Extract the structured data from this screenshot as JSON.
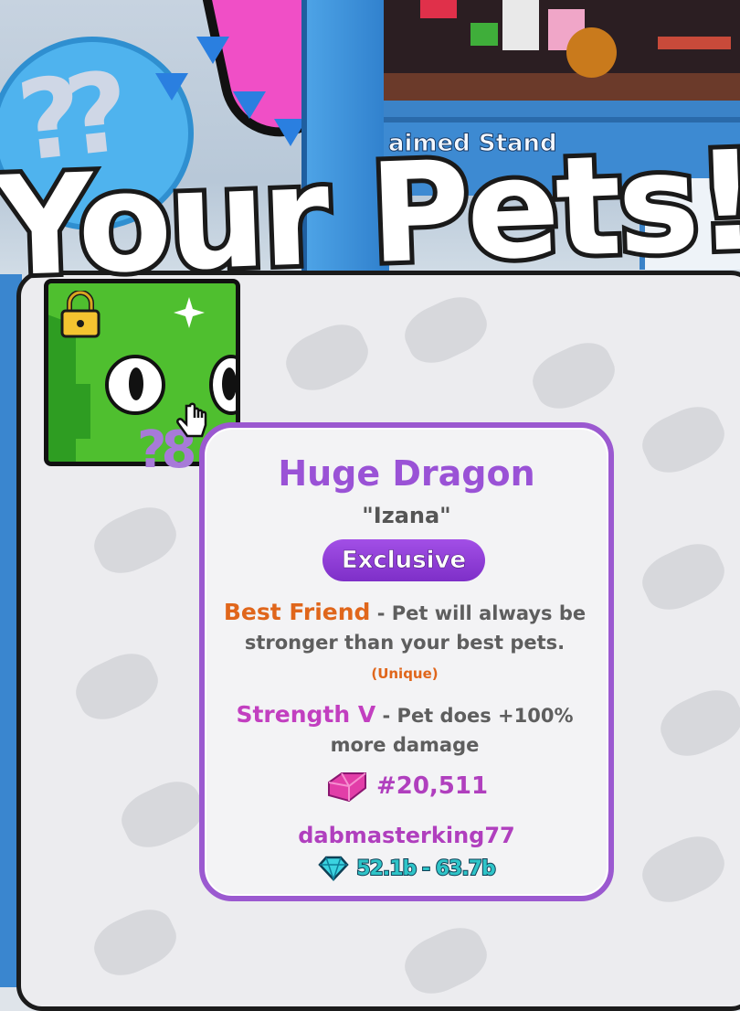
{
  "scene": {
    "stand_label": "aimed Stand"
  },
  "title": "Your Pets!",
  "pet_slot": {
    "locked_icon": "lock-icon",
    "sparkle_icon": "sparkle-icon",
    "corner_text": "?8"
  },
  "tooltip": {
    "pet_name": "Huge Dragon",
    "nickname": "\"Izana\"",
    "rarity": "Exclusive",
    "enchants": [
      {
        "name": "Best Friend",
        "separator": " - ",
        "description": "Pet will always be stronger than your best pets.",
        "tag": "(Unique)"
      },
      {
        "name": "Strength V",
        "separator": " - ",
        "description": "Pet does +100% more damage"
      }
    ],
    "serial_icon": "gem-icon",
    "serial": "#20,511",
    "owner": "dabmasterking77",
    "power_icon": "diamond-icon",
    "power_range": "52.1b - 63.7b"
  },
  "colors": {
    "tooltip_border": "#9b59d0",
    "pet_name": "#9a52d6",
    "rarity_badge": "#8e3ad6",
    "enchant_orange": "#e0661b",
    "enchant_pink": "#c23fc0",
    "owner": "#b03fbe",
    "power": "#2ec4c8",
    "pet_slot_bg": "#4fbf2f"
  }
}
